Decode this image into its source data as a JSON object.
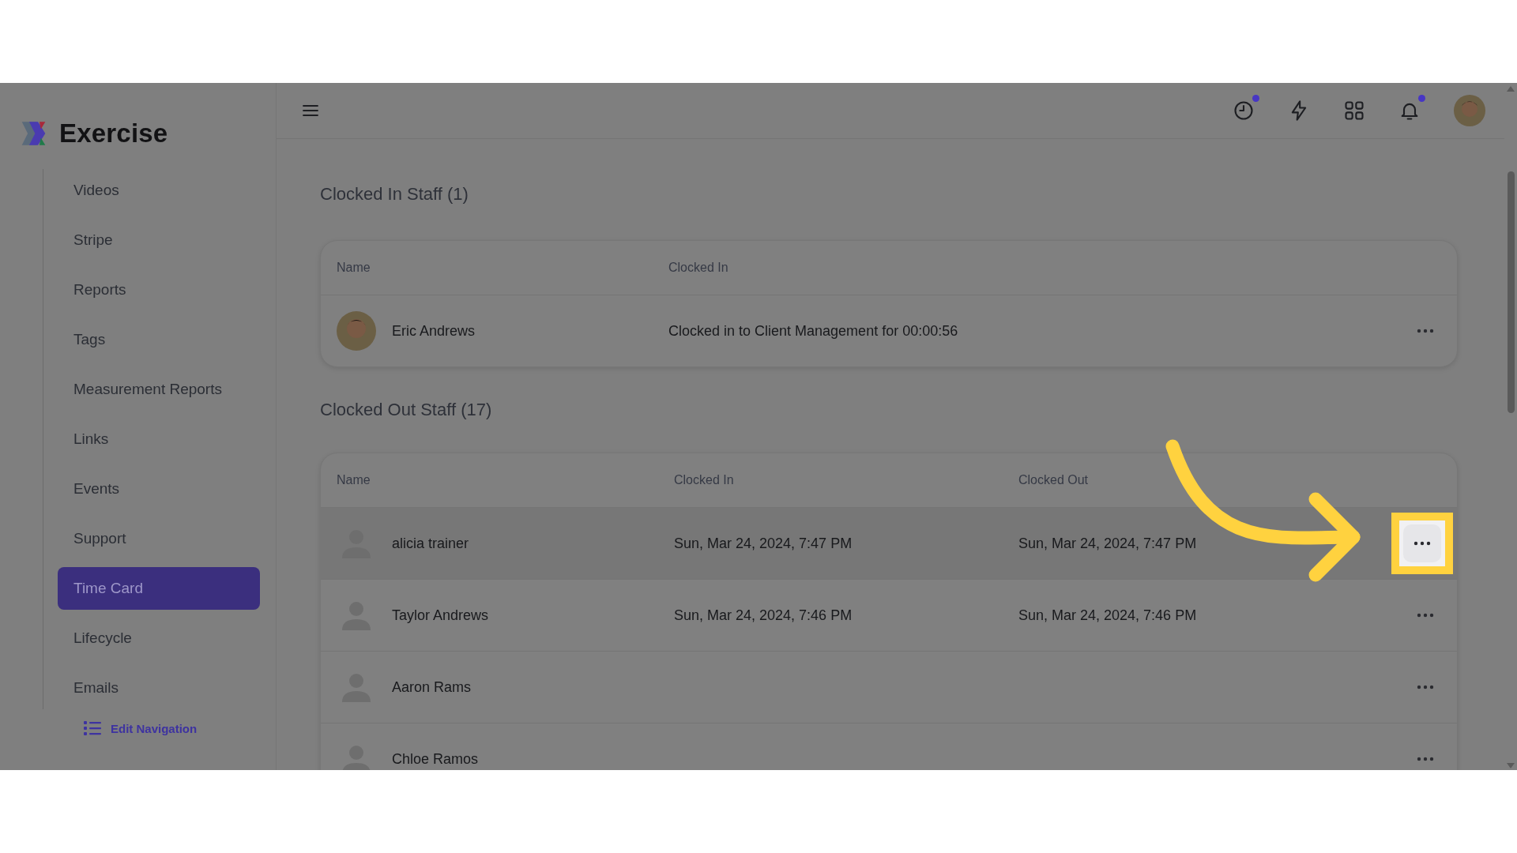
{
  "app": {
    "name": "Exercise"
  },
  "sidebar": {
    "items": [
      {
        "label": "Videos",
        "selected": false
      },
      {
        "label": "Stripe",
        "selected": false
      },
      {
        "label": "Reports",
        "selected": false
      },
      {
        "label": "Tags",
        "selected": false
      },
      {
        "label": "Measurement Reports",
        "selected": false
      },
      {
        "label": "Links",
        "selected": false
      },
      {
        "label": "Events",
        "selected": false
      },
      {
        "label": "Support",
        "selected": false
      },
      {
        "label": "Time Card",
        "selected": true
      },
      {
        "label": "Lifecycle",
        "selected": false
      },
      {
        "label": "Emails",
        "selected": false
      }
    ],
    "edit_navigation": "Edit Navigation"
  },
  "header": {
    "icons": [
      {
        "kind": "clock",
        "badge": true
      },
      {
        "kind": "bolt",
        "badge": false
      },
      {
        "kind": "grid",
        "badge": false
      },
      {
        "kind": "bell",
        "badge": true
      },
      {
        "kind": "avatar",
        "badge": false
      }
    ]
  },
  "clocked_in": {
    "title": "Clocked In Staff (1)",
    "columns": [
      "Name",
      "Clocked In"
    ],
    "rows": [
      {
        "name": "Eric Andrews",
        "has_photo": true,
        "clocked_in": "Clocked in to Client Management for 00:00:56",
        "highlighted": false
      }
    ]
  },
  "clocked_out": {
    "title": "Clocked Out Staff (17)",
    "columns": [
      "Name",
      "Clocked In",
      "Clocked Out"
    ],
    "rows": [
      {
        "name": "alicia trainer",
        "has_photo": false,
        "clocked_in": "Sun, Mar 24, 2024, 7:47 PM",
        "clocked_out": "Sun, Mar 24, 2024, 7:47 PM",
        "highlighted": true
      },
      {
        "name": "Taylor Andrews",
        "has_photo": false,
        "clocked_in": "Sun, Mar 24, 2024, 7:46 PM",
        "clocked_out": "Sun, Mar 24, 2024, 7:46 PM",
        "highlighted": false
      },
      {
        "name": "Aaron Rams",
        "has_photo": false,
        "highlighted": false
      },
      {
        "name": "Chloe Ramos",
        "has_photo": false,
        "highlighted": false
      }
    ]
  }
}
